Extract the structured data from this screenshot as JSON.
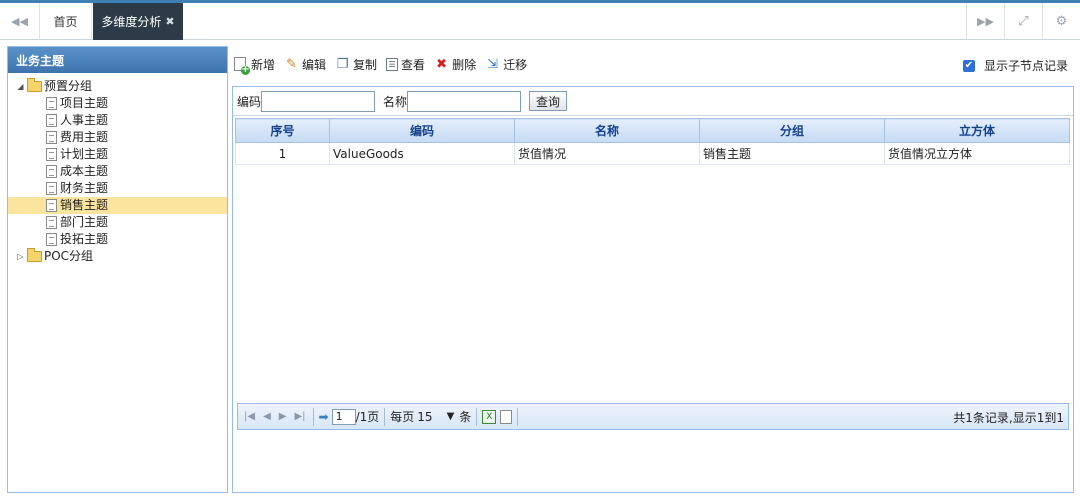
{
  "tabs": {
    "home_label": "首页",
    "active_label": "多维度分析",
    "close_glyph": "✖",
    "nav_left_glyph": "◀◀",
    "nav_right_glyph": "▶▶",
    "fullscreen_glyph": "⤢",
    "settings_glyph": "⚙"
  },
  "sidebar": {
    "title": "业务主题",
    "groups": [
      {
        "label": "预置分组",
        "expanded": true,
        "items": [
          "项目主题",
          "人事主题",
          "费用主题",
          "计划主题",
          "成本主题",
          "财务主题",
          "销售主题",
          "部门主题",
          "投拓主题"
        ],
        "selected": "销售主题"
      },
      {
        "label": "POC分组",
        "expanded": false,
        "items": []
      }
    ]
  },
  "toolbar": {
    "new_label": "新增",
    "edit_label": "编辑",
    "copy_label": "复制",
    "view_label": "查看",
    "delete_label": "删除",
    "migrate_label": "迁移",
    "show_children_label": "显示子节点记录",
    "show_children_checked": true
  },
  "search": {
    "code_label": "编码",
    "code_value": "",
    "name_label": "名称",
    "name_value": "",
    "query_label": "查询"
  },
  "grid": {
    "columns": [
      "序号",
      "编码",
      "名称",
      "分组",
      "立方体"
    ],
    "rows": [
      [
        "1",
        "ValueGoods",
        "货值情况",
        "销售主题",
        "货值情况立方体"
      ]
    ]
  },
  "pager": {
    "current_page": "1",
    "total_pages_text": "/1页",
    "per_page_label": "每页",
    "per_page_value": "15",
    "unit_label": "条",
    "summary": "共1条记录,显示1到1"
  },
  "colors": {
    "accent": "#3e7fb4",
    "active_tab": "#2c3b47",
    "selected_row": "#fbe49d",
    "header_text": "#15428b"
  }
}
